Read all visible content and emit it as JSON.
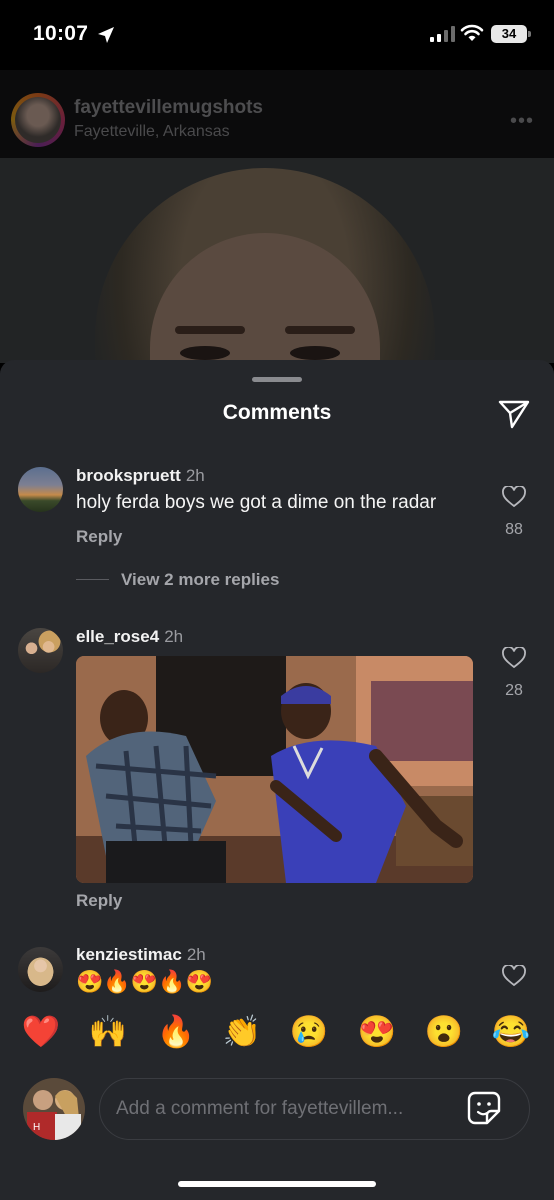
{
  "status": {
    "time": "10:07",
    "battery": "34"
  },
  "post": {
    "username": "fayettevillemugshots",
    "location": "Fayetteville, Arkansas",
    "more_icon": "ellipsis-icon"
  },
  "sheet": {
    "title": "Comments"
  },
  "comments": [
    {
      "username": "brookspruett",
      "time": "2h",
      "text": "holy ferda boys we got a dime on the radar",
      "reply_label": "Reply",
      "likes": "88",
      "view_more": "View 2 more replies"
    },
    {
      "username": "elle_rose4",
      "time": "2h",
      "reply_label": "Reply",
      "likes": "28",
      "attachment": "gif-image"
    },
    {
      "username": "kenziestimac",
      "time": "2h",
      "text": "😍🔥😍🔥😍"
    }
  ],
  "emoji_bar": [
    "❤️",
    "🙌",
    "🔥",
    "👏",
    "😢",
    "😍",
    "😮",
    "😂"
  ],
  "composer": {
    "placeholder": "Add a comment for fayettevillem..."
  },
  "colors": {
    "sheet_bg": "#25272b",
    "text_secondary": "#a5a6ab",
    "page_bg": "#000000"
  }
}
